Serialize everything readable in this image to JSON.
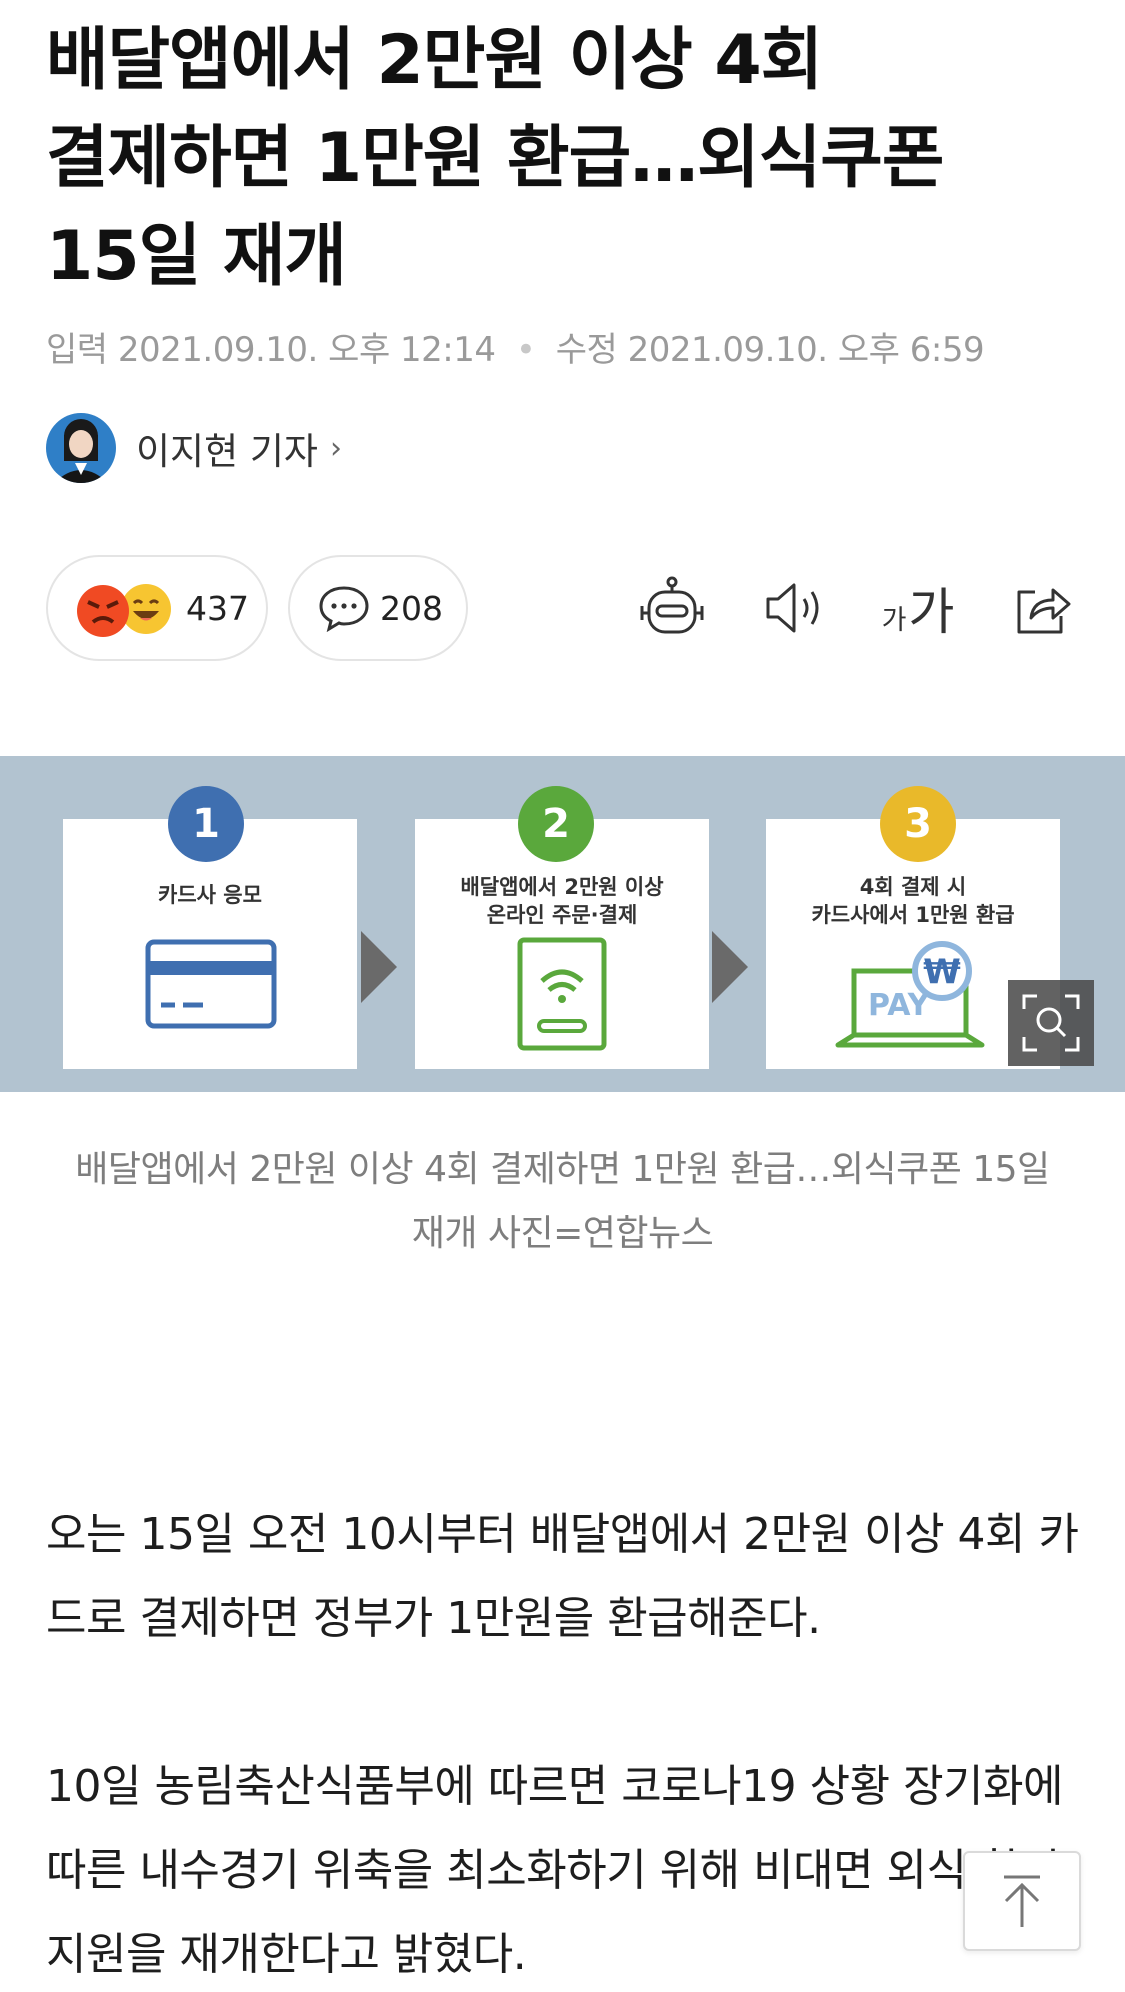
{
  "article": {
    "headline": "배달앱에서 2만원 이상 4회 결제하면 1만원 환급…외식쿠폰 15일 재개",
    "input_label": "입력",
    "input_time": "2021.09.10. 오후 12:14",
    "separator": "•",
    "modified_label": "수정",
    "modified_time": "2021.09.10. 오후 6:59",
    "author": "이지현 기자",
    "author_chevron": "›"
  },
  "actions": {
    "reactions_count": "437",
    "comments_count": "208",
    "font_small": "가",
    "font_large": "가",
    "icons": [
      "robot-icon",
      "speaker-icon",
      "font-size-icon",
      "share-icon"
    ]
  },
  "figure": {
    "steps": [
      {
        "number": "1",
        "text": "카드사 응모",
        "color": "#3f6fb0"
      },
      {
        "number": "2",
        "text": "배달앱에서 2만원 이상\n온라인 주문·결제",
        "color": "#5aa83c"
      },
      {
        "number": "3",
        "text": "4회 결제 시\n카드사에서 1만원 환급",
        "color": "#e9b92a"
      }
    ],
    "pay_text": "PAY",
    "won_symbol": "₩",
    "caption": "배달앱에서 2만원 이상 4회 결제하면 1만원 환급…외식쿠폰 15일 재개 사진=연합뉴스"
  },
  "body": {
    "paragraphs": [
      "오는 15일 오전 10시부터 배달앱에서 2만원 이상 4회 카드로 결제하면 정부가 1만원을 환급해준다.",
      "10일 농림축산식품부에 따르면 코로나19 상황 장기화에 따른 내수경기 위축을 최소화하기 위해 비대면 외식 할인 지원을 재개한다고 밝혔다."
    ]
  },
  "colors": {
    "figure_bg": "#b2c3d0",
    "angry_emoji": "#f04a23",
    "happy_emoji": "#f7c531"
  }
}
